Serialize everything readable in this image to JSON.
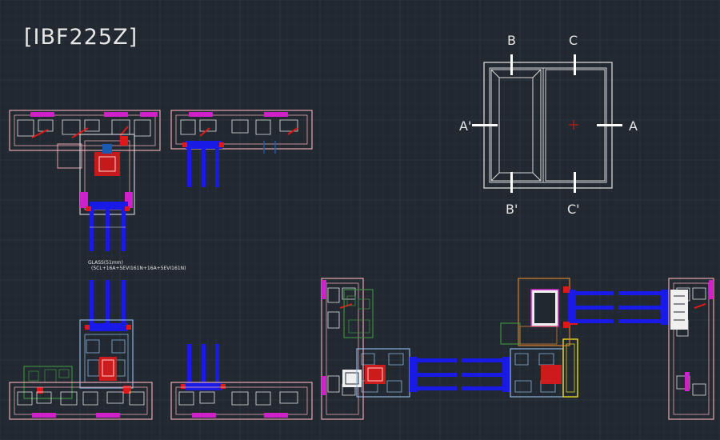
{
  "drawing": {
    "title": "[IBF225Z]",
    "glass_note_line1": "GLASS(51mm)",
    "glass_note_line2": "(5CL+16A+5EVI161N+16A+5EVI161N)"
  },
  "elevation": {
    "label_b_top": "B",
    "label_c_top": "C",
    "label_a_prime": "A'",
    "label_a": "A",
    "label_b_bottom": "B'",
    "label_c_bottom": "C'"
  },
  "colors": {
    "background": "#212830",
    "grid_minor": "#2a323c",
    "grid_major": "#333d49",
    "frame_white": "#d8d8d8",
    "glass_blue": "#1a1ae6",
    "gasket_red": "#e01818",
    "accent_magenta": "#d020c8",
    "profile_pink": "#e8a8b0",
    "profile_lightblue": "#8ab4e0",
    "profile_green": "#3c8c3c",
    "profile_orange": "#d88030",
    "profile_yellow": "#e0d020"
  }
}
